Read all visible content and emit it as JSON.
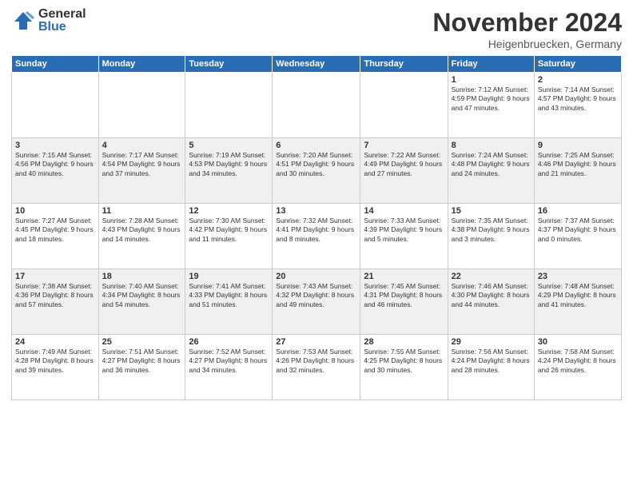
{
  "logo": {
    "general": "General",
    "blue": "Blue"
  },
  "title": "November 2024",
  "location": "Heigenbruecken, Germany",
  "weekdays": [
    "Sunday",
    "Monday",
    "Tuesday",
    "Wednesday",
    "Thursday",
    "Friday",
    "Saturday"
  ],
  "weeks": [
    [
      {
        "day": "",
        "info": ""
      },
      {
        "day": "",
        "info": ""
      },
      {
        "day": "",
        "info": ""
      },
      {
        "day": "",
        "info": ""
      },
      {
        "day": "",
        "info": ""
      },
      {
        "day": "1",
        "info": "Sunrise: 7:12 AM\nSunset: 4:59 PM\nDaylight: 9 hours\nand 47 minutes."
      },
      {
        "day": "2",
        "info": "Sunrise: 7:14 AM\nSunset: 4:57 PM\nDaylight: 9 hours\nand 43 minutes."
      }
    ],
    [
      {
        "day": "3",
        "info": "Sunrise: 7:15 AM\nSunset: 4:56 PM\nDaylight: 9 hours\nand 40 minutes."
      },
      {
        "day": "4",
        "info": "Sunrise: 7:17 AM\nSunset: 4:54 PM\nDaylight: 9 hours\nand 37 minutes."
      },
      {
        "day": "5",
        "info": "Sunrise: 7:19 AM\nSunset: 4:53 PM\nDaylight: 9 hours\nand 34 minutes."
      },
      {
        "day": "6",
        "info": "Sunrise: 7:20 AM\nSunset: 4:51 PM\nDaylight: 9 hours\nand 30 minutes."
      },
      {
        "day": "7",
        "info": "Sunrise: 7:22 AM\nSunset: 4:49 PM\nDaylight: 9 hours\nand 27 minutes."
      },
      {
        "day": "8",
        "info": "Sunrise: 7:24 AM\nSunset: 4:48 PM\nDaylight: 9 hours\nand 24 minutes."
      },
      {
        "day": "9",
        "info": "Sunrise: 7:25 AM\nSunset: 4:46 PM\nDaylight: 9 hours\nand 21 minutes."
      }
    ],
    [
      {
        "day": "10",
        "info": "Sunrise: 7:27 AM\nSunset: 4:45 PM\nDaylight: 9 hours\nand 18 minutes."
      },
      {
        "day": "11",
        "info": "Sunrise: 7:28 AM\nSunset: 4:43 PM\nDaylight: 9 hours\nand 14 minutes."
      },
      {
        "day": "12",
        "info": "Sunrise: 7:30 AM\nSunset: 4:42 PM\nDaylight: 9 hours\nand 11 minutes."
      },
      {
        "day": "13",
        "info": "Sunrise: 7:32 AM\nSunset: 4:41 PM\nDaylight: 9 hours\nand 8 minutes."
      },
      {
        "day": "14",
        "info": "Sunrise: 7:33 AM\nSunset: 4:39 PM\nDaylight: 9 hours\nand 5 minutes."
      },
      {
        "day": "15",
        "info": "Sunrise: 7:35 AM\nSunset: 4:38 PM\nDaylight: 9 hours\nand 3 minutes."
      },
      {
        "day": "16",
        "info": "Sunrise: 7:37 AM\nSunset: 4:37 PM\nDaylight: 9 hours\nand 0 minutes."
      }
    ],
    [
      {
        "day": "17",
        "info": "Sunrise: 7:38 AM\nSunset: 4:36 PM\nDaylight: 8 hours\nand 57 minutes."
      },
      {
        "day": "18",
        "info": "Sunrise: 7:40 AM\nSunset: 4:34 PM\nDaylight: 8 hours\nand 54 minutes."
      },
      {
        "day": "19",
        "info": "Sunrise: 7:41 AM\nSunset: 4:33 PM\nDaylight: 8 hours\nand 51 minutes."
      },
      {
        "day": "20",
        "info": "Sunrise: 7:43 AM\nSunset: 4:32 PM\nDaylight: 8 hours\nand 49 minutes."
      },
      {
        "day": "21",
        "info": "Sunrise: 7:45 AM\nSunset: 4:31 PM\nDaylight: 8 hours\nand 46 minutes."
      },
      {
        "day": "22",
        "info": "Sunrise: 7:46 AM\nSunset: 4:30 PM\nDaylight: 8 hours\nand 44 minutes."
      },
      {
        "day": "23",
        "info": "Sunrise: 7:48 AM\nSunset: 4:29 PM\nDaylight: 8 hours\nand 41 minutes."
      }
    ],
    [
      {
        "day": "24",
        "info": "Sunrise: 7:49 AM\nSunset: 4:28 PM\nDaylight: 8 hours\nand 39 minutes."
      },
      {
        "day": "25",
        "info": "Sunrise: 7:51 AM\nSunset: 4:27 PM\nDaylight: 8 hours\nand 36 minutes."
      },
      {
        "day": "26",
        "info": "Sunrise: 7:52 AM\nSunset: 4:27 PM\nDaylight: 8 hours\nand 34 minutes."
      },
      {
        "day": "27",
        "info": "Sunrise: 7:53 AM\nSunset: 4:26 PM\nDaylight: 8 hours\nand 32 minutes."
      },
      {
        "day": "28",
        "info": "Sunrise: 7:55 AM\nSunset: 4:25 PM\nDaylight: 8 hours\nand 30 minutes."
      },
      {
        "day": "29",
        "info": "Sunrise: 7:56 AM\nSunset: 4:24 PM\nDaylight: 8 hours\nand 28 minutes."
      },
      {
        "day": "30",
        "info": "Sunrise: 7:58 AM\nSunset: 4:24 PM\nDaylight: 8 hours\nand 26 minutes."
      }
    ]
  ]
}
